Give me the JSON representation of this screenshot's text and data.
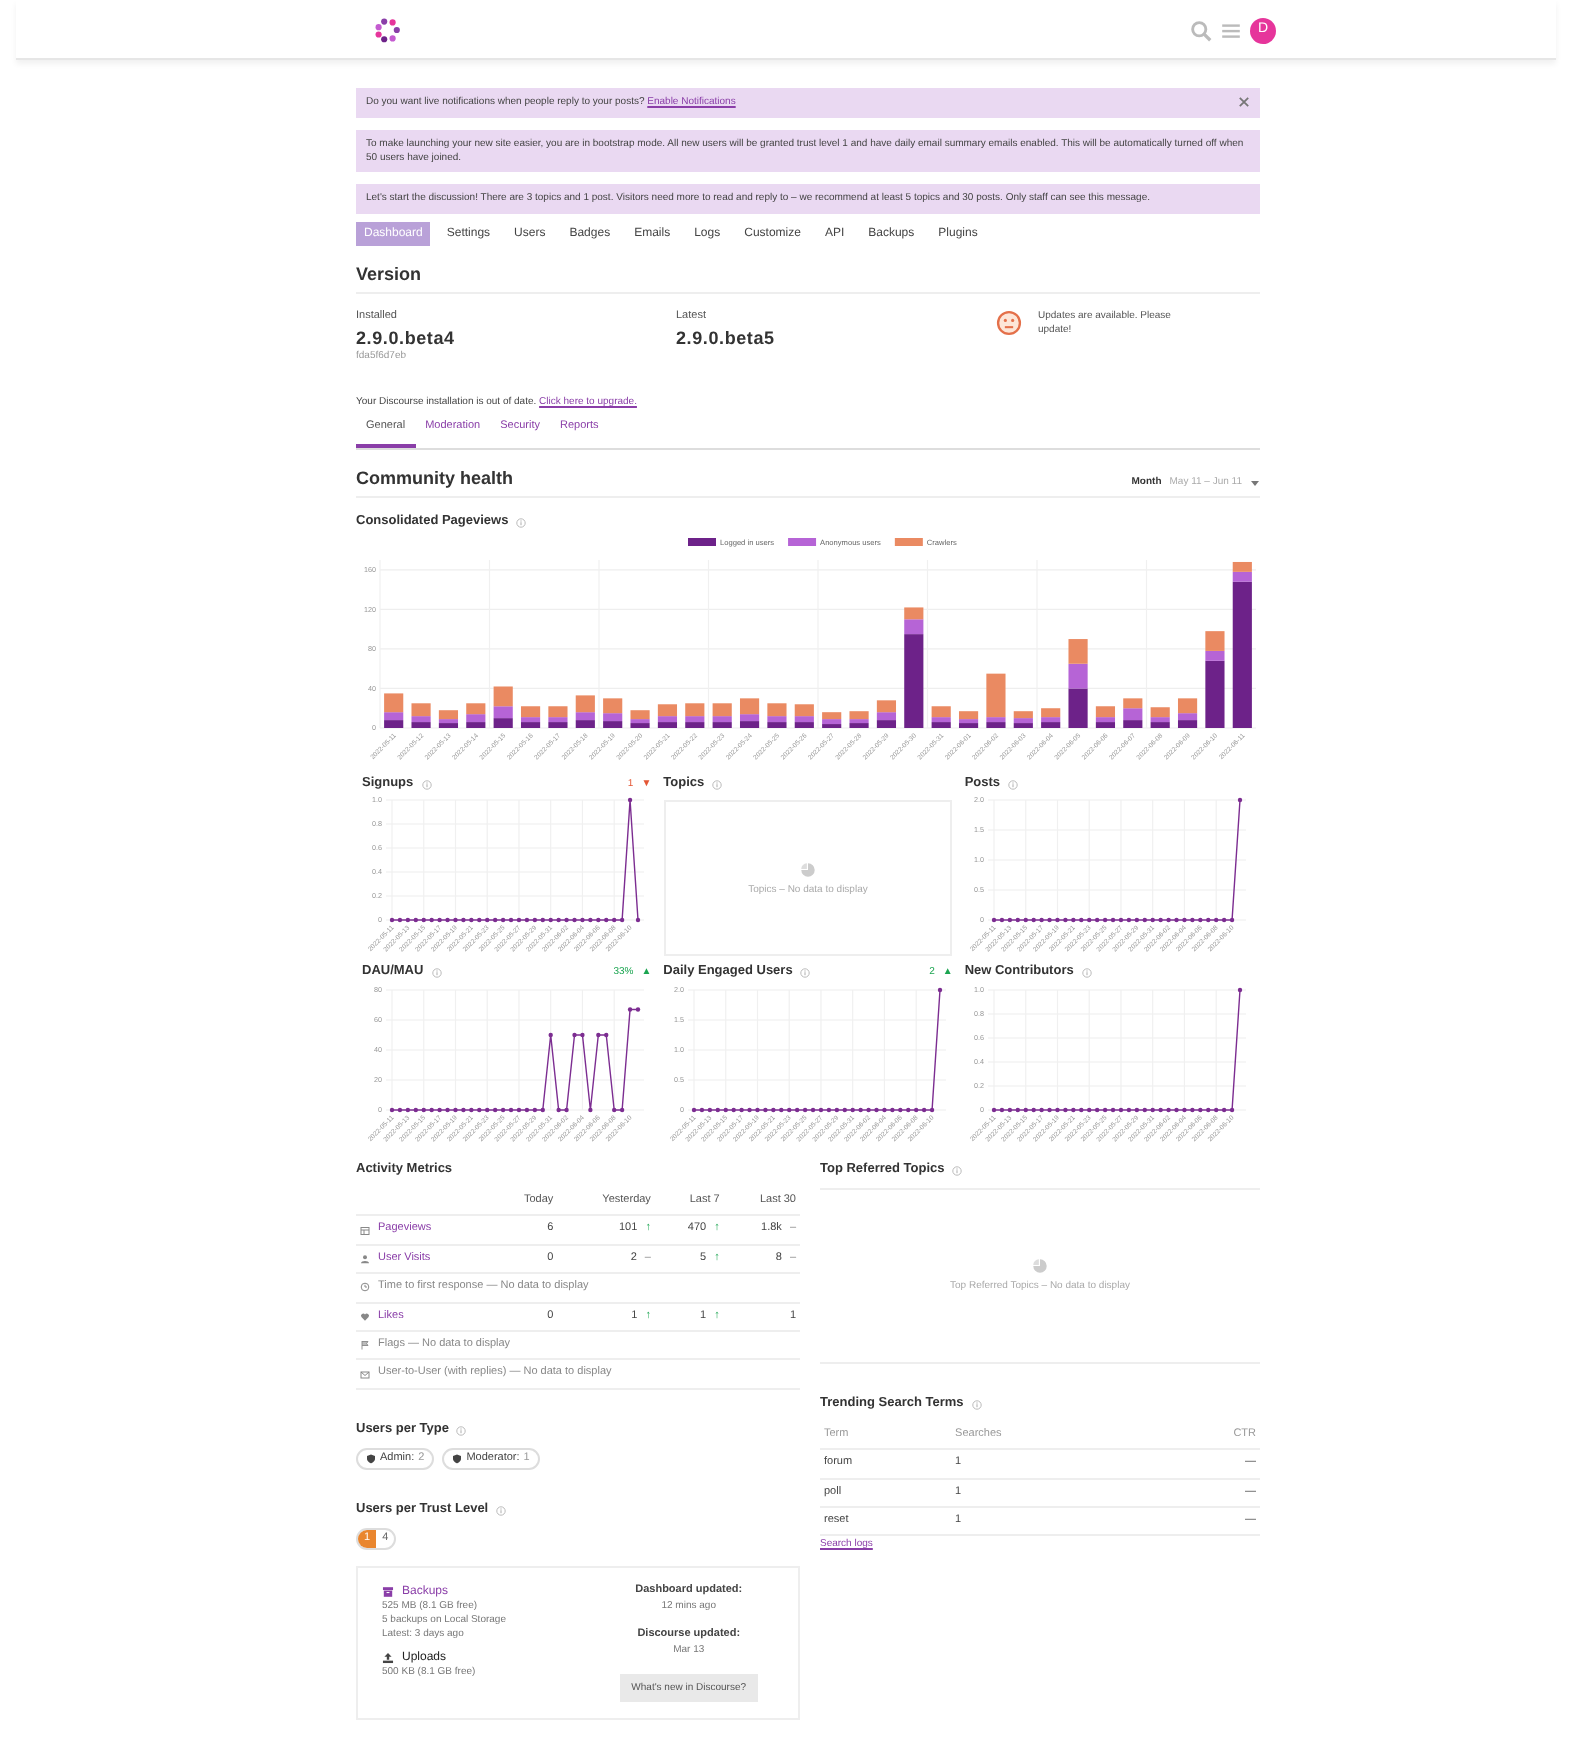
{
  "header": {
    "avatar_letter": "D"
  },
  "banners": [
    {
      "text": "Do you want live notifications when people reply to your posts?",
      "link": "Enable Notifications",
      "dismissible": true
    },
    {
      "text": "To make launching your new site easier, you are in bootstrap mode. All new users will be granted trust level 1 and have daily email summary emails enabled. This will be automatically turned off when 50 users have joined.",
      "dismissible": false
    },
    {
      "text": "Let's start the discussion! There are 3 topics and 1 post. Visitors need more to read and reply to – we recommend at least 5 topics and 30 posts. Only staff can see this message.",
      "dismissible": false
    }
  ],
  "nav": [
    {
      "label": "Dashboard",
      "selected": true
    },
    {
      "label": "Settings",
      "selected": false
    },
    {
      "label": "Users",
      "selected": false
    },
    {
      "label": "Badges",
      "selected": false
    },
    {
      "label": "Emails",
      "selected": false
    },
    {
      "label": "Logs",
      "selected": false
    },
    {
      "label": "Customize",
      "selected": false
    },
    {
      "label": "API",
      "selected": false
    },
    {
      "label": "Backups",
      "selected": false
    },
    {
      "label": "Plugins",
      "selected": false
    }
  ],
  "version": {
    "title": "Version",
    "installed_label": "Installed",
    "installed": "2.9.0.beta4",
    "installed_hash": "fda5f6d7eb",
    "latest_label": "Latest",
    "latest": "2.9.0.beta5",
    "status": "Updates are available. Please update!"
  },
  "upgrade_notice": {
    "text": "Your Discourse installation is out of date.",
    "link": "Click here to upgrade."
  },
  "tabs": [
    {
      "label": "General",
      "selected": true
    },
    {
      "label": "Moderation",
      "selected": false
    },
    {
      "label": "Security",
      "selected": false
    },
    {
      "label": "Reports",
      "selected": false
    }
  ],
  "health": {
    "title": "Community health",
    "period": "Month",
    "range": "May 11 – Jun 11"
  },
  "pageviews": {
    "title": "Consolidated Pageviews",
    "chart_data": {
      "type": "bar",
      "stacked": true,
      "grid": true,
      "legend": true,
      "categories": [
        "2022-05-11",
        "2022-05-12",
        "2022-05-13",
        "2022-05-14",
        "2022-05-15",
        "2022-05-16",
        "2022-05-17",
        "2022-05-18",
        "2022-05-19",
        "2022-05-20",
        "2022-05-21",
        "2022-05-22",
        "2022-05-23",
        "2022-05-24",
        "2022-05-25",
        "2022-05-26",
        "2022-05-27",
        "2022-05-28",
        "2022-05-29",
        "2022-05-30",
        "2022-05-31",
        "2022-06-01",
        "2022-06-02",
        "2022-06-03",
        "2022-06-04",
        "2022-06-05",
        "2022-06-06",
        "2022-06-07",
        "2022-06-08",
        "2022-06-09",
        "2022-06-10",
        "2022-06-11"
      ],
      "series": [
        {
          "name": "Logged in users",
          "color": "#6d2289",
          "values": [
            8,
            6,
            5,
            6,
            10,
            6,
            6,
            8,
            7,
            5,
            6,
            6,
            6,
            7,
            6,
            6,
            4,
            5,
            8,
            95,
            6,
            5,
            6,
            5,
            6,
            40,
            6,
            8,
            6,
            8,
            68,
            148
          ]
        },
        {
          "name": "Anonymous users",
          "color": "#b664d6",
          "values": [
            8,
            6,
            4,
            8,
            12,
            5,
            5,
            8,
            8,
            4,
            6,
            6,
            6,
            7,
            6,
            6,
            5,
            4,
            8,
            15,
            5,
            4,
            5,
            5,
            5,
            25,
            5,
            12,
            5,
            7,
            10,
            10
          ]
        },
        {
          "name": "Crawlers",
          "color": "#ea8a62",
          "values": [
            19,
            13,
            9,
            11,
            20,
            11,
            11,
            17,
            15,
            9,
            12,
            13,
            13,
            16,
            13,
            12,
            7,
            8,
            12,
            12,
            11,
            8,
            44,
            7,
            9,
            25,
            11,
            10,
            10,
            15,
            20,
            10
          ]
        }
      ],
      "ylim": [
        0,
        170
      ],
      "yticks": [
        0,
        40,
        80,
        120,
        160
      ]
    }
  },
  "mini_charts": [
    {
      "title": "Signups",
      "trend": {
        "value": "1",
        "arrow": "▼",
        "rising": false
      },
      "chart_data": {
        "type": "line",
        "grid": true,
        "categories": [
          "2022-05-11",
          null,
          "2022-05-13",
          null,
          "2022-05-15",
          null,
          "2022-05-17",
          null,
          "2022-05-19",
          null,
          "2022-05-21",
          null,
          "2022-05-23",
          null,
          "2022-05-25",
          null,
          "2022-05-27",
          null,
          "2022-05-29",
          null,
          "2022-05-31",
          null,
          "2022-06-02",
          null,
          "2022-06-04",
          null,
          "2022-06-06",
          null,
          "2022-06-08",
          null,
          "2022-06-10",
          null
        ],
        "series": [
          {
            "color": "#7c2d91",
            "values": [
              0,
              0,
              0,
              0,
              0,
              0,
              0,
              0,
              0,
              0,
              0,
              0,
              0,
              0,
              0,
              0,
              0,
              0,
              0,
              0,
              0,
              0,
              0,
              0,
              0,
              0,
              0,
              0,
              0,
              0,
              1,
              0
            ]
          }
        ],
        "ylim": [
          0,
          1
        ],
        "yticks": [
          0,
          {
            "value": 0.2,
            "label": "0.2"
          },
          {
            "value": 0.4,
            "label": "0.4"
          },
          {
            "value": 0.6,
            "label": "0.6"
          },
          {
            "value": 0.8,
            "label": "0.8"
          },
          {
            "value": 1,
            "label": "1.0"
          }
        ]
      }
    },
    {
      "title": "Topics",
      "empty": "Topics – No data to display"
    },
    {
      "title": "Posts",
      "chart_data": {
        "type": "line",
        "grid": true,
        "categories": [
          "2022-05-11",
          null,
          "2022-05-13",
          null,
          "2022-05-15",
          null,
          "2022-05-17",
          null,
          "2022-05-19",
          null,
          "2022-05-21",
          null,
          "2022-05-23",
          null,
          "2022-05-25",
          null,
          "2022-05-27",
          null,
          "2022-05-29",
          null,
          "2022-05-31",
          null,
          "2022-06-02",
          null,
          "2022-06-04",
          null,
          "2022-06-06",
          null,
          "2022-06-08",
          null,
          "2022-06-10",
          null
        ],
        "series": [
          {
            "color": "#7c2d91",
            "values": [
              0,
              0,
              0,
              0,
              0,
              0,
              0,
              0,
              0,
              0,
              0,
              0,
              0,
              0,
              0,
              0,
              0,
              0,
              0,
              0,
              0,
              0,
              0,
              0,
              0,
              0,
              0,
              0,
              0,
              0,
              0,
              2
            ]
          }
        ],
        "ylim": [
          0,
          2
        ],
        "yticks": [
          0,
          {
            "value": 0.5,
            "label": "0.5"
          },
          {
            "value": 1,
            "label": "1.0"
          },
          {
            "value": 1.5,
            "label": "1.5"
          },
          {
            "value": 2,
            "label": "2.0"
          }
        ]
      }
    },
    {
      "title": "DAU/MAU",
      "trend": {
        "value": "33%",
        "arrow": "▲",
        "rising": true
      },
      "chart_data": {
        "type": "line",
        "grid": true,
        "categories": [
          "2022-05-11",
          null,
          "2022-05-13",
          null,
          "2022-05-15",
          null,
          "2022-05-17",
          null,
          "2022-05-19",
          null,
          "2022-05-21",
          null,
          "2022-05-23",
          null,
          "2022-05-25",
          null,
          "2022-05-27",
          null,
          "2022-05-29",
          null,
          "2022-05-31",
          null,
          "2022-06-02",
          null,
          "2022-06-04",
          null,
          "2022-06-06",
          null,
          "2022-06-08",
          null,
          "2022-06-10",
          null
        ],
        "series": [
          {
            "color": "#7c2d91",
            "values": [
              0,
              0,
              0,
              0,
              0,
              0,
              0,
              0,
              0,
              0,
              0,
              0,
              0,
              0,
              0,
              0,
              0,
              0,
              0,
              0,
              50,
              0,
              0,
              50,
              50,
              0,
              50,
              50,
              0,
              0,
              67,
              67
            ]
          }
        ],
        "ylim": [
          0,
          80
        ],
        "yticks": [
          0,
          20,
          40,
          60,
          80
        ]
      }
    },
    {
      "title": "Daily Engaged Users",
      "trend": {
        "value": "2",
        "arrow": "▲",
        "rising": true
      },
      "chart_data": {
        "type": "line",
        "grid": true,
        "categories": [
          "2022-05-11",
          null,
          "2022-05-13",
          null,
          "2022-05-15",
          null,
          "2022-05-17",
          null,
          "2022-05-19",
          null,
          "2022-05-21",
          null,
          "2022-05-23",
          null,
          "2022-05-25",
          null,
          "2022-05-27",
          null,
          "2022-05-29",
          null,
          "2022-05-31",
          null,
          "2022-06-02",
          null,
          "2022-06-04",
          null,
          "2022-06-06",
          null,
          "2022-06-08",
          null,
          "2022-06-10",
          null
        ],
        "series": [
          {
            "color": "#7c2d91",
            "values": [
              0,
              0,
              0,
              0,
              0,
              0,
              0,
              0,
              0,
              0,
              0,
              0,
              0,
              0,
              0,
              0,
              0,
              0,
              0,
              0,
              0,
              0,
              0,
              0,
              0,
              0,
              0,
              0,
              0,
              0,
              0,
              2
            ]
          }
        ],
        "ylim": [
          0,
          2
        ],
        "yticks": [
          0,
          {
            "value": 0.5,
            "label": "0.5"
          },
          {
            "value": 1,
            "label": "1.0"
          },
          {
            "value": 1.5,
            "label": "1.5"
          },
          {
            "value": 2,
            "label": "2.0"
          }
        ]
      }
    },
    {
      "title": "New Contributors",
      "chart_data": {
        "type": "line",
        "grid": true,
        "categories": [
          "2022-05-11",
          null,
          "2022-05-13",
          null,
          "2022-05-15",
          null,
          "2022-05-17",
          null,
          "2022-05-19",
          null,
          "2022-05-21",
          null,
          "2022-05-23",
          null,
          "2022-05-25",
          null,
          "2022-05-27",
          null,
          "2022-05-29",
          null,
          "2022-05-31",
          null,
          "2022-06-02",
          null,
          "2022-06-04",
          null,
          "2022-06-06",
          null,
          "2022-06-08",
          null,
          "2022-06-10",
          null
        ],
        "series": [
          {
            "color": "#7c2d91",
            "values": [
              0,
              0,
              0,
              0,
              0,
              0,
              0,
              0,
              0,
              0,
              0,
              0,
              0,
              0,
              0,
              0,
              0,
              0,
              0,
              0,
              0,
              0,
              0,
              0,
              0,
              0,
              0,
              0,
              0,
              0,
              0,
              1
            ]
          }
        ],
        "ylim": [
          0,
          1
        ],
        "yticks": [
          0,
          {
            "value": 0.2,
            "label": "0.2"
          },
          {
            "value": 0.4,
            "label": "0.4"
          },
          {
            "value": 0.6,
            "label": "0.6"
          },
          {
            "value": 0.8,
            "label": "0.8"
          },
          {
            "value": 1,
            "label": "1.0"
          }
        ]
      }
    }
  ],
  "activity": {
    "title": "Activity Metrics",
    "columns": [
      "Today",
      "Yesterday",
      "Last 7",
      "Last 30"
    ],
    "rows": [
      {
        "kind": "metric",
        "label": "Pageviews",
        "cells": [
          {
            "value": "6"
          },
          {
            "value": "101",
            "trend": "↑",
            "rising": true
          },
          {
            "value": "470",
            "trend": "↑",
            "rising": true
          },
          {
            "value": "1.8k",
            "trend": "–",
            "rising": false
          }
        ]
      },
      {
        "kind": "metric",
        "label": "User Visits",
        "cells": [
          {
            "value": "0"
          },
          {
            "value": "2",
            "trend": "–",
            "rising": false
          },
          {
            "value": "5",
            "trend": "↑",
            "rising": true
          },
          {
            "value": "8",
            "trend": "–",
            "rising": false
          }
        ]
      },
      {
        "kind": "empty",
        "label": "Time to first response — No data to display"
      },
      {
        "kind": "metric",
        "label": "Likes",
        "cells": [
          {
            "value": "0"
          },
          {
            "value": "1",
            "trend": "↑",
            "rising": true
          },
          {
            "value": "1",
            "trend": "↑",
            "rising": true
          },
          {
            "value": "1"
          }
        ]
      },
      {
        "kind": "empty",
        "label": "Flags — No data to display"
      },
      {
        "kind": "empty",
        "label": "User-to-User (with replies) — No data to display"
      }
    ]
  },
  "referred": {
    "title": "Top Referred Topics",
    "empty": "Top Referred Topics – No data to display"
  },
  "search_terms": {
    "title": "Trending Search Terms",
    "columns": [
      "Term",
      "Searches",
      "CTR"
    ],
    "rows": [
      [
        "forum",
        "1",
        "—"
      ],
      [
        "poll",
        "1",
        "—"
      ],
      [
        "reset",
        "1",
        "—"
      ]
    ],
    "link": "Search logs"
  },
  "users_per_type": {
    "title": "Users per Type",
    "items": [
      {
        "label": "Admin:",
        "count": "2"
      },
      {
        "label": "Moderator:",
        "count": "1"
      }
    ]
  },
  "trust_levels": {
    "title": "Users per Trust Level",
    "items": [
      {
        "label": "1",
        "count": "4",
        "color": "#e9862f"
      }
    ]
  },
  "storage": {
    "backups_title": "Backups",
    "backups_lines": [
      "525 MB (8.1 GB free)",
      "5 backups on Local Storage",
      "Latest: 3 days ago"
    ],
    "uploads_title": "Uploads",
    "uploads_lines": [
      "500 KB (8.1 GB free)"
    ],
    "dashboard_label": "Dashboard updated:",
    "dashboard_value": "12 mins ago",
    "discourse_label": "Discourse updated:",
    "discourse_value": "Mar 13",
    "button": "What's new in Discourse?"
  }
}
